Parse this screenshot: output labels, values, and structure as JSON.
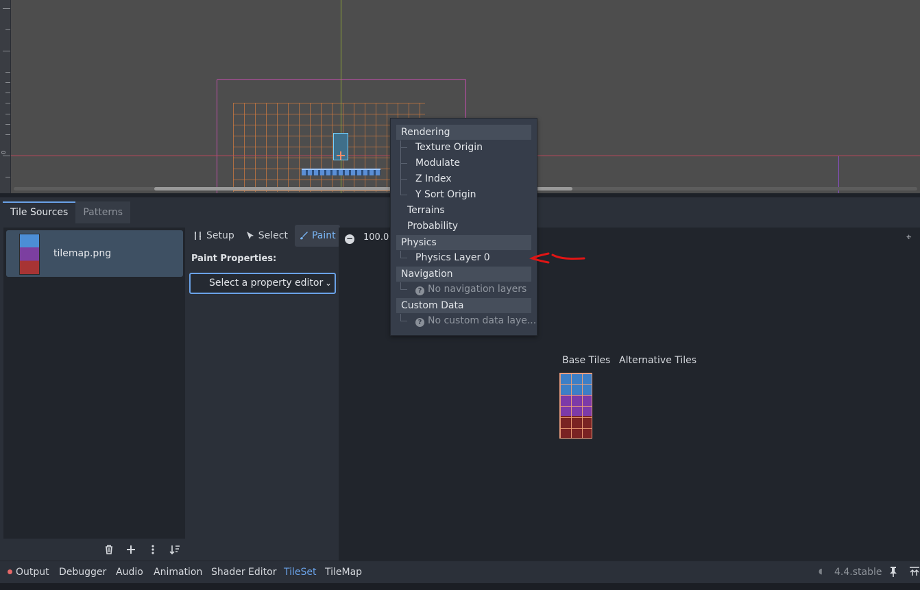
{
  "viewport": {
    "ruler_zero": "0"
  },
  "panel": {
    "tabs": [
      {
        "label": "Tile Sources",
        "active": true
      },
      {
        "label": "Patterns",
        "active": false
      }
    ],
    "source": {
      "name": "tilemap.png"
    },
    "modes": {
      "setup": "Setup",
      "select": "Select",
      "paint": "Paint"
    },
    "paint_properties_label": "Paint Properties:",
    "property_editor_placeholder": "Select a property editor",
    "zoom_value": "100.0",
    "base_tiles": "Base Tiles",
    "alternative_tiles": "Alternative Tiles"
  },
  "menu": {
    "rendering": "Rendering",
    "texture_origin": "Texture Origin",
    "modulate": "Modulate",
    "z_index": "Z Index",
    "y_sort_origin": "Y Sort Origin",
    "terrains": "Terrains",
    "probability": "Probability",
    "physics": "Physics",
    "physics_layer_0": "Physics Layer 0",
    "navigation": "Navigation",
    "no_navigation_layers": "No navigation layers",
    "custom_data": "Custom Data",
    "no_custom_data_layers": "No custom data laye..."
  },
  "dock": {
    "output": "Output",
    "debugger": "Debugger",
    "audio": "Audio",
    "animation": "Animation",
    "shader_editor": "Shader Editor",
    "tileset": "TileSet",
    "tilemap": "TileMap",
    "version": "4.4.stable"
  },
  "colors": {
    "accent": "#6aa2e8",
    "annotation": "#e01515",
    "output_error_dot": "#e66868"
  }
}
